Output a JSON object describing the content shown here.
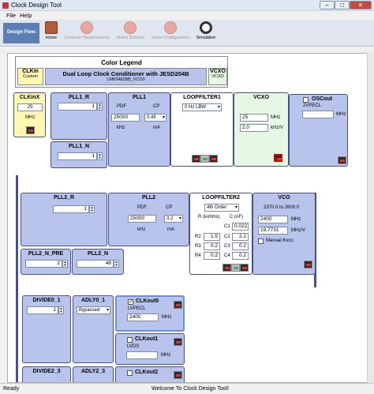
{
  "window": {
    "title": "Clock Design Tool",
    "min": "–",
    "max": "□",
    "close": "✕"
  },
  "menu": [
    "File",
    "Help"
  ],
  "toolbar": {
    "flow_label": "Design Flow:",
    "items": [
      "Home",
      "Customer Requirements",
      "Select Solution",
      "Select Configuration",
      "Simulation"
    ]
  },
  "legend": {
    "title": "Color Legend",
    "clkin": "CLKin",
    "custom": "Custom",
    "device": "Dual Loop Clock Conditioner with JESD204B",
    "part": "LMK04828B_VCO0",
    "vcxo": "VCXO",
    "vcxo_sub": "VCXO"
  },
  "clkinx": {
    "title": "CLKinX",
    "value": "25",
    "unit": "MHz"
  },
  "pll1_r": {
    "title": "PLL1_R",
    "value": "1"
  },
  "pll1": {
    "title": "PLL1",
    "pdf_label": "PDF",
    "cp_label": "CP",
    "pdf": "25000",
    "cp": "0.45",
    "pdf_unit": "kHz",
    "cp_unit": "mA"
  },
  "loopfilter1": {
    "title": "LOOPFILTER1",
    "mode": "0 Hz LBW"
  },
  "vcxo": {
    "title": "VCXO",
    "freq": "25",
    "freq_unit": "MHz",
    "gain": "2.0",
    "gain_unit": "kHz/V"
  },
  "oscout": {
    "title": "OSCout",
    "type": "2VPECL",
    "value": "",
    "unit": "MHz"
  },
  "pll1_n": {
    "title": "PLL1_N",
    "value": "1"
  },
  "pll2_r": {
    "title": "PLL2_R",
    "value": "1"
  },
  "pll2": {
    "title": "PLL2",
    "pdf_label": "PDF",
    "cp_label": "CP",
    "pdf": "25000",
    "cp": "3.2",
    "pdf_unit": "kHz",
    "cp_unit": "mA"
  },
  "loopfilter2": {
    "title": "LOOPFILTER2",
    "order": "4th Order",
    "r_header": "R (kohms)",
    "c_header": "C (nF)",
    "rows": [
      {
        "rlabel": "",
        "rval": "",
        "clabel": "C1",
        "cval": "0.022"
      },
      {
        "rlabel": "R2",
        "rval": "1.5",
        "clabel": "C2",
        "cval": "2.2"
      },
      {
        "rlabel": "R3",
        "rval": "0.2",
        "clabel": "C3",
        "cval": "0.2"
      },
      {
        "rlabel": "R4",
        "rval": "0.2",
        "clabel": "C4",
        "cval": "0.2"
      }
    ]
  },
  "vco": {
    "title": "VCO",
    "range": "2370.0 to 2600.0",
    "freq": "2400",
    "freq_unit": "MHz",
    "gain": "19.7731",
    "gain_unit": "MHz/V",
    "manual": "Manual Kvco"
  },
  "pll2_n_pre": {
    "title": "PLL2_N_PRE",
    "value": "2"
  },
  "pll2_n": {
    "title": "PLL2_N",
    "value": "48"
  },
  "divide0_1": {
    "title": "DIVIDE0_1",
    "value": "1"
  },
  "adly0_1": {
    "title": "ADLY0_1",
    "mode": "Bypassed"
  },
  "clkout0": {
    "title": "CLKout0",
    "type": "LVPECL",
    "value": "2400",
    "unit": "MHz",
    "check": "✓"
  },
  "clkout1": {
    "title": "CLKout1",
    "type": "LVDS",
    "value": "",
    "unit": "MHz"
  },
  "bottom": {
    "divide2_3": "DIVIDE2_3",
    "adly2_3": "ADLY2_3",
    "clkout2": "CLKout2"
  },
  "status": {
    "left": "Ready",
    "center": "Welcome To Clock Design Tool!"
  }
}
